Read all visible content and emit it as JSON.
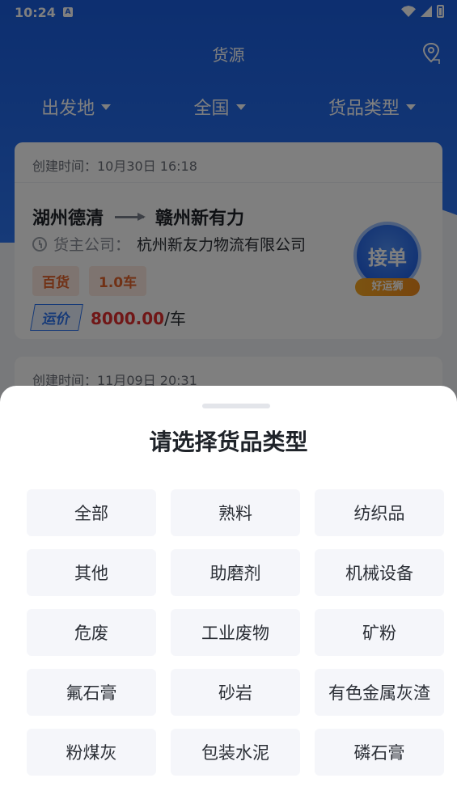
{
  "status_bar": {
    "time": "10:24",
    "notif_icon": "a-icon"
  },
  "header": {
    "title": "货源"
  },
  "filters": [
    {
      "label": "出发地"
    },
    {
      "label": "全国"
    },
    {
      "label": "货品类型"
    }
  ],
  "cards": [
    {
      "created": "创建时间：10月30日 16:18",
      "from": "湖州德清",
      "to": "赣州新有力",
      "company_label": "货主公司：",
      "company": "杭州新友力物流有限公司",
      "tags": [
        "百货",
        "1.0车"
      ],
      "price_label": "运价",
      "price": "8000.00",
      "price_unit": "/车",
      "accept_label": "接单",
      "accept_badge": "好运狮"
    },
    {
      "created": "创建时间：11月09日 20:31"
    }
  ],
  "sheet": {
    "title": "请选择货品类型",
    "options": [
      "全部",
      "熟料",
      "纺织品",
      "其他",
      "助磨剂",
      "机械设备",
      "危废",
      "工业废物",
      "矿粉",
      "氟石膏",
      "砂岩",
      "有色金属灰渣",
      "粉煤灰",
      "包装水泥",
      "磷石膏"
    ]
  }
}
